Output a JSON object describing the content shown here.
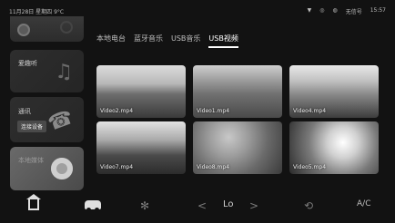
{
  "status": {
    "left": "11月28日  星期四  9°C",
    "right_items": [
      "▼",
      "◎",
      "◍",
      "无信号",
      "15:57"
    ]
  },
  "sidebar": {
    "music_title": "爱趣听",
    "phone_title": "通讯",
    "phone_connect_label": "连接设备",
    "media_title": "本地媒体"
  },
  "tabs": [
    {
      "label": "本地电台"
    },
    {
      "label": "蓝牙音乐"
    },
    {
      "label": "USB音乐"
    },
    {
      "label": "USB视频",
      "active": true
    }
  ],
  "videos": [
    {
      "name": "Video2.mp4"
    },
    {
      "name": "Video1.mp4"
    },
    {
      "name": "Video4.mp4"
    },
    {
      "name": "Video7.mp4"
    },
    {
      "name": "Video8.mp4"
    },
    {
      "name": "Video5.mp4"
    }
  ],
  "bottom": {
    "prev": "<",
    "temp": "Lo",
    "next": ">",
    "ac": "A/C"
  }
}
